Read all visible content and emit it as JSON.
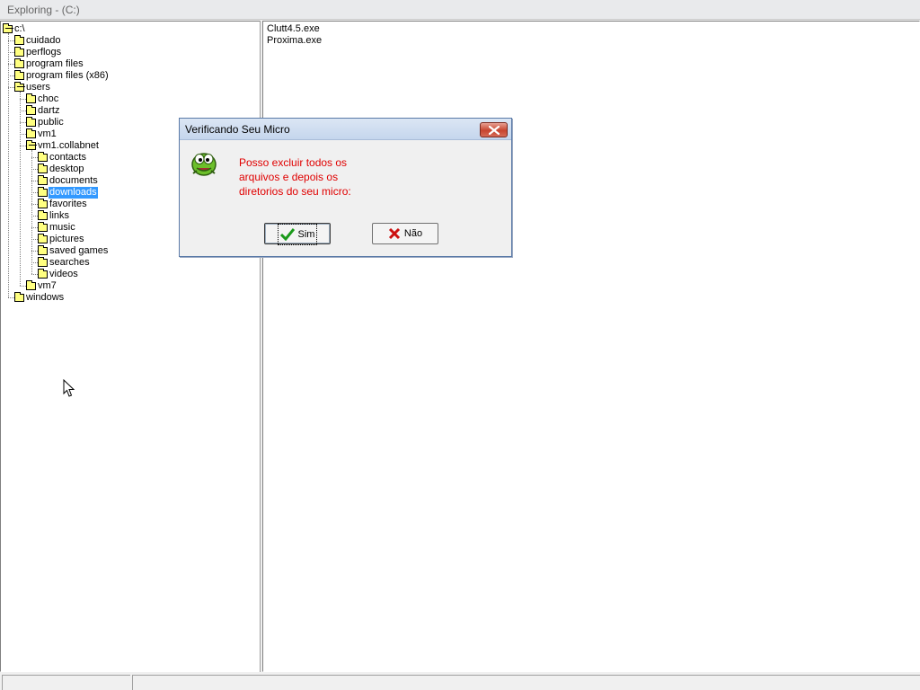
{
  "window": {
    "title": "Exploring - (C:)"
  },
  "tree": [
    {
      "label": "c:\\",
      "depth": 0,
      "open": true
    },
    {
      "label": "cuidado",
      "depth": 1
    },
    {
      "label": "perflogs",
      "depth": 1
    },
    {
      "label": "program files",
      "depth": 1
    },
    {
      "label": "program files (x86)",
      "depth": 1
    },
    {
      "label": "users",
      "depth": 1,
      "open": true
    },
    {
      "label": "choc",
      "depth": 2
    },
    {
      "label": "dartz",
      "depth": 2
    },
    {
      "label": "public",
      "depth": 2
    },
    {
      "label": "vm1",
      "depth": 2
    },
    {
      "label": "vm1.collabnet",
      "depth": 2,
      "open": true
    },
    {
      "label": "contacts",
      "depth": 3
    },
    {
      "label": "desktop",
      "depth": 3
    },
    {
      "label": "documents",
      "depth": 3
    },
    {
      "label": "downloads",
      "depth": 3,
      "selected": true
    },
    {
      "label": "favorites",
      "depth": 3
    },
    {
      "label": "links",
      "depth": 3
    },
    {
      "label": "music",
      "depth": 3
    },
    {
      "label": "pictures",
      "depth": 3
    },
    {
      "label": "saved games",
      "depth": 3
    },
    {
      "label": "searches",
      "depth": 3
    },
    {
      "label": "videos",
      "depth": 3
    },
    {
      "label": "vm7",
      "depth": 2
    },
    {
      "label": "windows",
      "depth": 1
    }
  ],
  "files": [
    "Clutt4.5.exe",
    "Proxima.exe"
  ],
  "dialog": {
    "title": "Verificando Seu Micro",
    "message_lines": [
      "Posso excluir todos os",
      "arquivos e depois os",
      "diretorios do seu micro:"
    ],
    "yes_label": "Sim",
    "no_label": "Não",
    "message_color": "#e00000",
    "icon": "green-monster-icon"
  },
  "colors": {
    "selection": "#3399ff",
    "folder": "#ffff80"
  }
}
